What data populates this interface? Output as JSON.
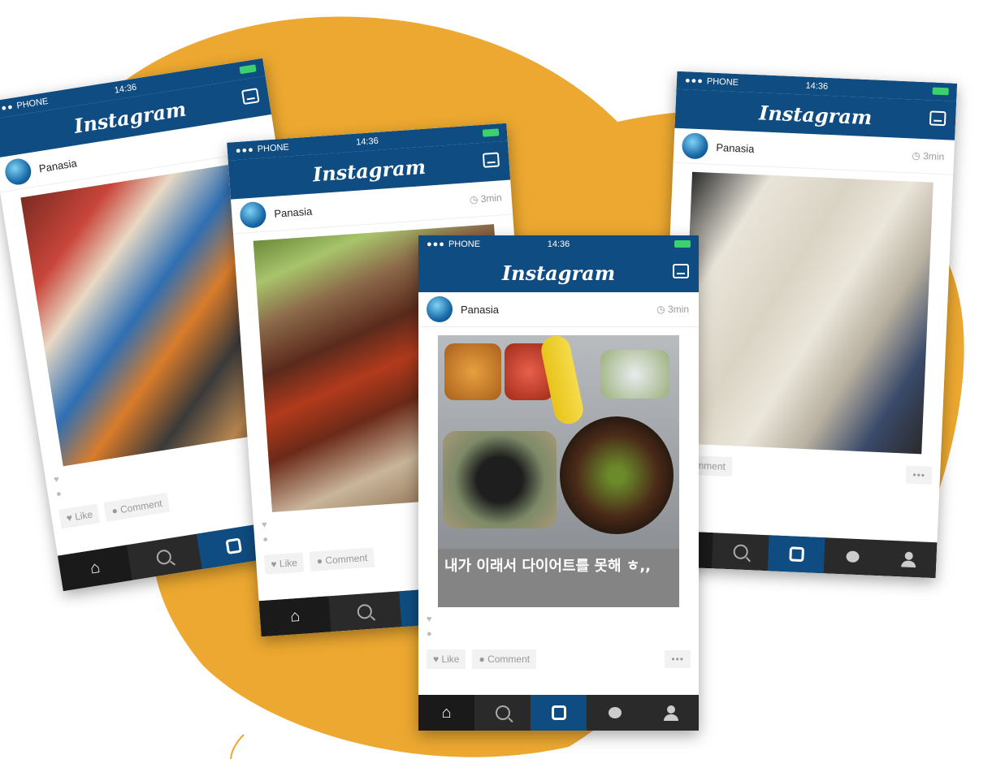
{
  "colors": {
    "accent_orange": "#eca830",
    "ig_blue": "#0f4c81",
    "battery_green": "#3bd16f"
  },
  "phones": [
    {
      "status": {
        "carrier": "PHONE",
        "time": "14:36"
      },
      "app_title": "Instagram",
      "user": "Panasia",
      "time_ago": "",
      "caption": "",
      "like_label": "Like",
      "comment_label": "Comment"
    },
    {
      "status": {
        "carrier": "PHONE",
        "time": "14:36"
      },
      "app_title": "Instagram",
      "user": "Panasia",
      "time_ago": "3min",
      "caption": "",
      "like_label": "Like",
      "comment_label": "Comment"
    },
    {
      "status": {
        "carrier": "PHONE",
        "time": "14:36"
      },
      "app_title": "Instagram",
      "user": "Panasia",
      "time_ago": "3min",
      "caption": "내가 이래서 다이어트를 못해 ㅎ,,",
      "like_label": "Like",
      "comment_label": "Comment",
      "more_label": "•••"
    },
    {
      "status": {
        "carrier": "PHONE",
        "time": "14:36"
      },
      "app_title": "Instagram",
      "user": "Panasia",
      "time_ago": "3min",
      "caption": "",
      "like_label": "",
      "comment_label": "Comment",
      "more_label": "•••"
    }
  ]
}
